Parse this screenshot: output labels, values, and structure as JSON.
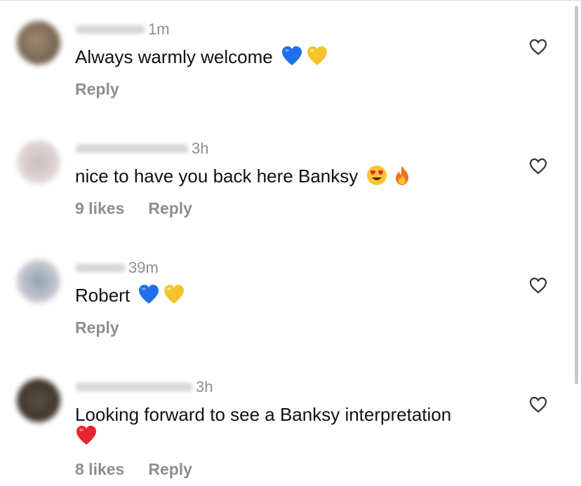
{
  "comments": [
    {
      "time": "1m",
      "text": "Always warmly welcome",
      "emojis": [
        "blue-heart",
        "yellow-heart"
      ],
      "likes": "",
      "reply_label": "Reply",
      "avatar_color": "#7a6a58"
    },
    {
      "time": "3h",
      "text": "nice to have you back here Banksy",
      "emojis": [
        "heart-eyes",
        "fire"
      ],
      "likes": "9 likes",
      "reply_label": "Reply",
      "avatar_color": "#cfcac6"
    },
    {
      "time": "39m",
      "text": "Robert",
      "emojis": [
        "blue-heart",
        "yellow-heart"
      ],
      "likes": "",
      "reply_label": "Reply",
      "avatar_color": "#8fa3b0"
    },
    {
      "time": "3h",
      "text": "Looking forward to see a Banksy interpretation",
      "emojis": [
        "red-heart"
      ],
      "likes": "8 likes",
      "reply_label": "Reply",
      "avatar_color": "#4a4036"
    }
  ],
  "colors": {
    "secondary_text": "#8e8e8e",
    "blue_heart": "#1e6fe8",
    "yellow_heart": "#f5c32c",
    "red_heart": "#e6262e",
    "fire": "#f2731c"
  }
}
